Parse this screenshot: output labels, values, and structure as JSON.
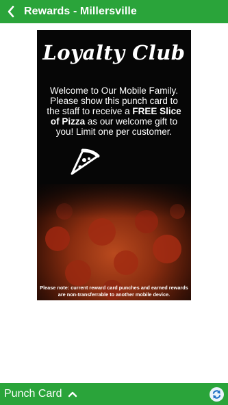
{
  "header": {
    "title": "Rewards - Millersville",
    "back_icon": "chevron-left-icon",
    "background_color": "#2aa43a"
  },
  "card": {
    "title": "Loyalty Club",
    "message_part1": "Welcome to Our Mobile Family. Please show this punch card to the staff to receive a ",
    "message_bold": "FREE Slice of Pizza",
    "message_part2": " as our welcome gift to you! Limit one per customer.",
    "icon": "pizza-slice-icon",
    "note": "Please note: current reward card punches and earned rewards are non-transferrable to another mobile device."
  },
  "footer": {
    "label": "Punch Card",
    "expand_icon": "chevron-up-icon",
    "refresh_icon": "refresh-icon"
  }
}
